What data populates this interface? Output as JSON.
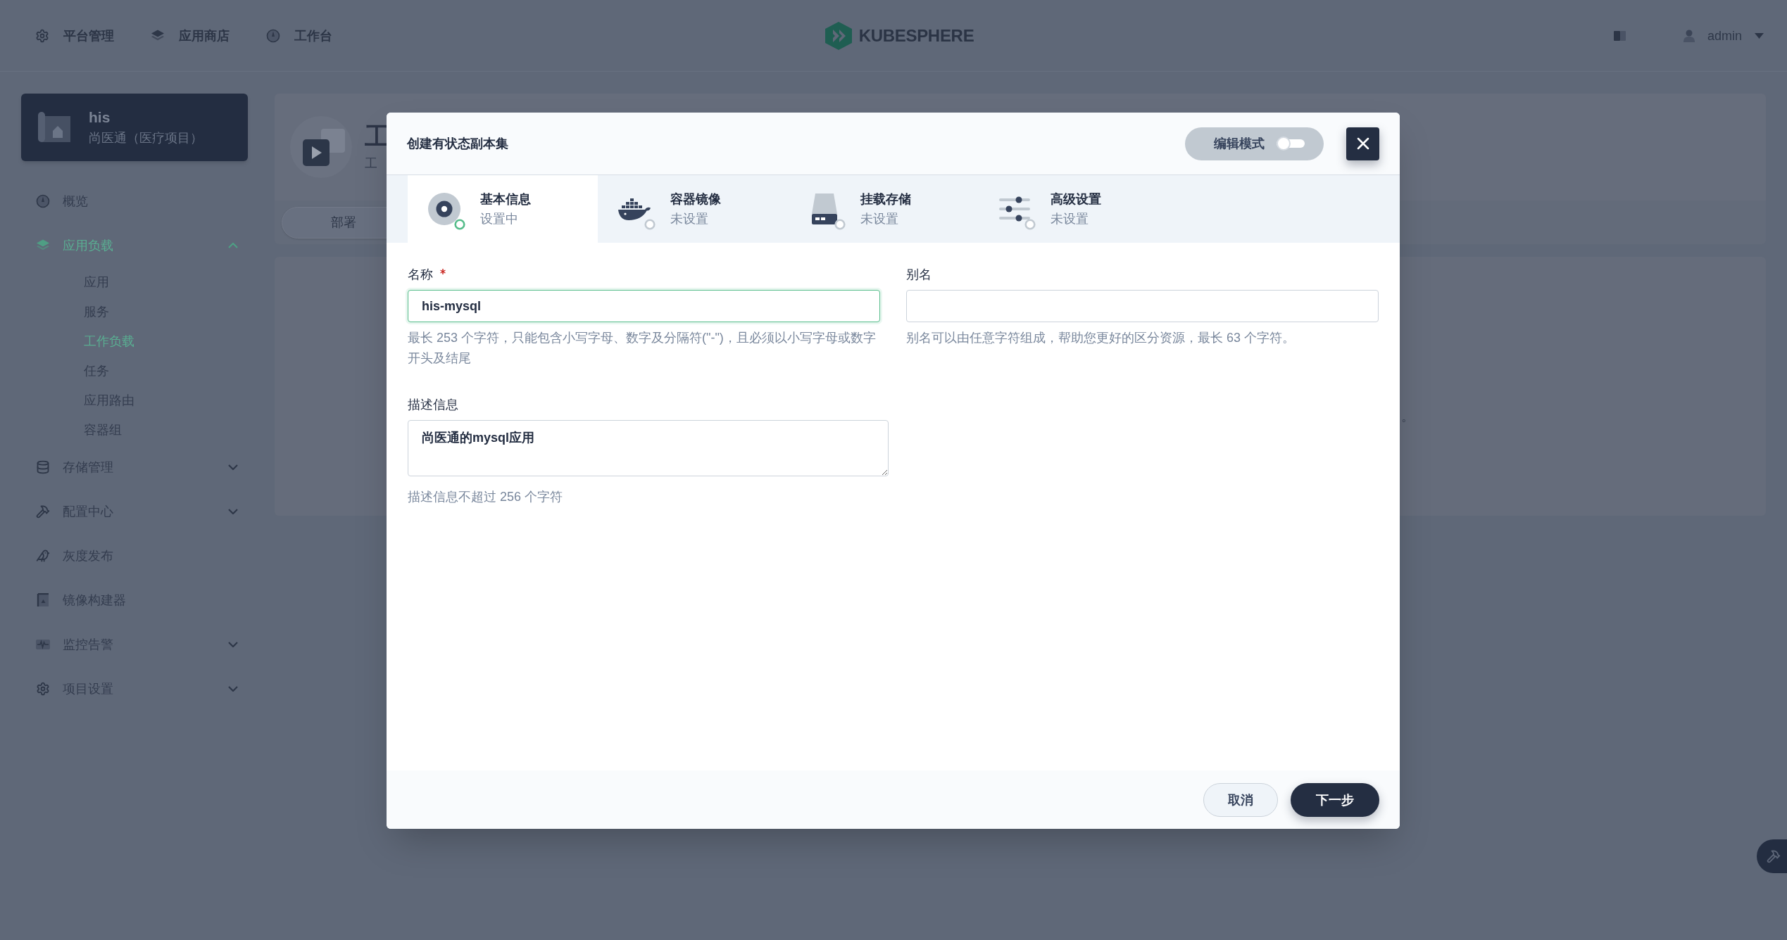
{
  "top_nav": {
    "items": [
      {
        "label": "平台管理"
      },
      {
        "label": "应用商店"
      },
      {
        "label": "工作台"
      }
    ],
    "logo": "KUBESPHERE",
    "user": "admin"
  },
  "sidebar": {
    "project": {
      "name": "his",
      "description": "尚医通（医疗项目）"
    },
    "items": [
      {
        "kind": "link",
        "label": "概览",
        "selected": false
      },
      {
        "kind": "group",
        "label": "应用负载",
        "selected": true,
        "expanded": true,
        "children": [
          {
            "label": "应用",
            "selected": false
          },
          {
            "label": "服务",
            "selected": false
          },
          {
            "label": "工作负载",
            "selected": true
          },
          {
            "label": "任务",
            "selected": false
          },
          {
            "label": "应用路由",
            "selected": false
          },
          {
            "label": "容器组",
            "selected": false
          }
        ]
      },
      {
        "kind": "group",
        "label": "存储管理",
        "selected": false,
        "expanded": false
      },
      {
        "kind": "group",
        "label": "配置中心",
        "selected": false,
        "expanded": false
      },
      {
        "kind": "link",
        "label": "灰度发布",
        "selected": false
      },
      {
        "kind": "link",
        "label": "镜像构建器",
        "selected": false
      },
      {
        "kind": "group",
        "label": "监控告警",
        "selected": false,
        "expanded": false
      },
      {
        "kind": "group",
        "label": "项目设置",
        "selected": false,
        "expanded": false
      }
    ]
  },
  "page": {
    "title": "工",
    "subtitle": "工",
    "tabs": [
      {
        "label": "部署",
        "selected": true
      }
    ],
    "note": "。"
  },
  "dialog": {
    "title": "创建有状态副本集",
    "edit_mode": {
      "label": "编辑模式",
      "on": false
    },
    "steps": [
      {
        "title": "基本信息",
        "status": "设置中",
        "selected": true
      },
      {
        "title": "容器镜像",
        "status": "未设置",
        "selected": false
      },
      {
        "title": "挂载存储",
        "status": "未设置",
        "selected": false
      },
      {
        "title": "高级设置",
        "status": "未设置",
        "selected": false
      }
    ],
    "fields": [
      {
        "kind": "input",
        "label": "名称",
        "required": true,
        "focused": true,
        "value": "his-mysql",
        "hint": "最长 253 个字符，只能包含小写字母、数字及分隔符(\"-\")，且必须以小写字母或数字开头及结尾"
      },
      {
        "kind": "input",
        "label": "别名",
        "required": false,
        "focused": false,
        "hint": "别名可以由任意字符组成，帮助您更好的区分资源，最长 63 个字符。"
      },
      {
        "kind": "textarea",
        "label": "描述信息",
        "required": false,
        "focused": false,
        "value": "尚医通的mysql应用",
        "hint": "描述信息不超过 256 个字符"
      }
    ],
    "buttons": [
      {
        "kind": "secondary",
        "label": "取消"
      },
      {
        "kind": "primary",
        "label": "下一步"
      }
    ]
  }
}
